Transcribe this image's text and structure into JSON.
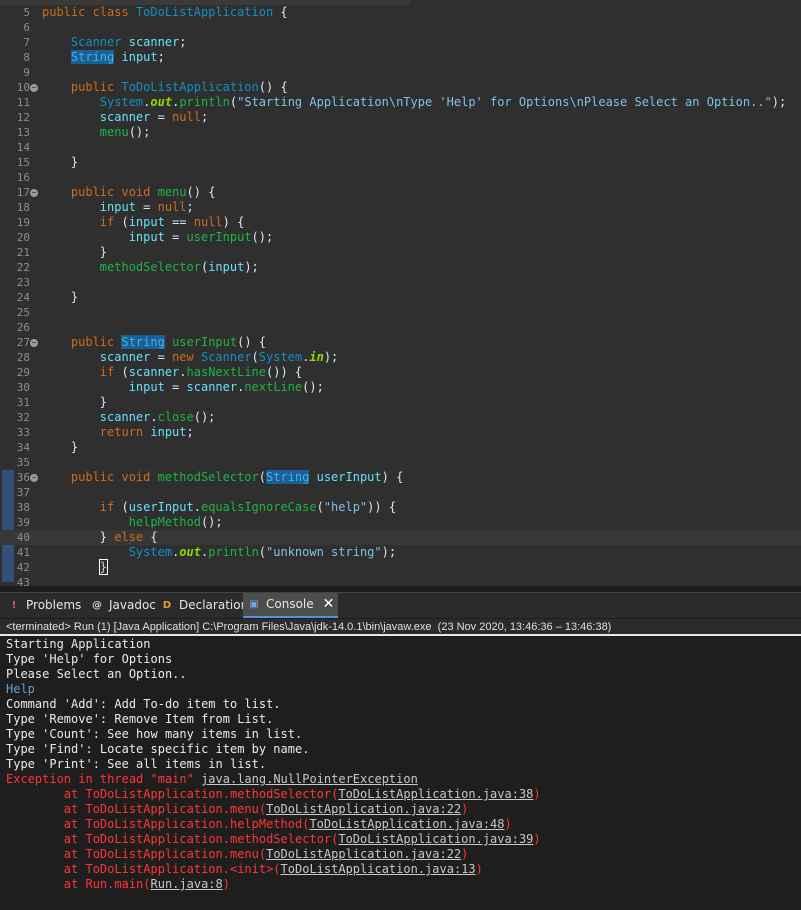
{
  "editor": {
    "lines": [
      {
        "n": "5",
        "fold": false,
        "tokens": [
          [
            "kw",
            "public class "
          ],
          [
            "ty",
            "ToDoListApplication"
          ],
          [
            "pl",
            " {"
          ]
        ]
      },
      {
        "n": "6",
        "fold": false,
        "tokens": []
      },
      {
        "n": "7",
        "fold": false,
        "tokens": [
          [
            "pl",
            "    "
          ],
          [
            "ty",
            "Scanner"
          ],
          [
            "pl",
            " "
          ],
          [
            "fd",
            "scanner"
          ],
          [
            "pl",
            ";"
          ]
        ]
      },
      {
        "n": "8",
        "fold": false,
        "tokens": [
          [
            "pl",
            "    "
          ],
          [
            "hl",
            "String"
          ],
          [
            "pl",
            " "
          ],
          [
            "fd",
            "input"
          ],
          [
            "pl",
            ";"
          ]
        ]
      },
      {
        "n": "9",
        "fold": false,
        "tokens": []
      },
      {
        "n": "10",
        "fold": true,
        "tokens": [
          [
            "pl",
            "    "
          ],
          [
            "kw",
            "public "
          ],
          [
            "ty",
            "ToDoListApplication"
          ],
          [
            "pl",
            "() {"
          ]
        ]
      },
      {
        "n": "11",
        "fold": false,
        "tokens": [
          [
            "pl",
            "        "
          ],
          [
            "ty",
            "System"
          ],
          [
            "pl",
            "."
          ],
          [
            "sf",
            "out"
          ],
          [
            "pl",
            "."
          ],
          [
            "mt",
            "println"
          ],
          [
            "pl",
            "("
          ],
          [
            "st",
            "\"Starting Application\\nType 'Help' for Options\\nPlease Select an Option..\""
          ],
          [
            "pl",
            ");"
          ]
        ]
      },
      {
        "n": "12",
        "fold": false,
        "tokens": [
          [
            "pl",
            "        "
          ],
          [
            "fd",
            "scanner"
          ],
          [
            "pl",
            " = "
          ],
          [
            "kw",
            "null"
          ],
          [
            "pl",
            ";"
          ]
        ]
      },
      {
        "n": "13",
        "fold": false,
        "tokens": [
          [
            "pl",
            "        "
          ],
          [
            "mt",
            "menu"
          ],
          [
            "pl",
            "();"
          ]
        ]
      },
      {
        "n": "14",
        "fold": false,
        "tokens": []
      },
      {
        "n": "15",
        "fold": false,
        "tokens": [
          [
            "pl",
            "    }"
          ]
        ]
      },
      {
        "n": "16",
        "fold": false,
        "tokens": []
      },
      {
        "n": "17",
        "fold": true,
        "tokens": [
          [
            "pl",
            "    "
          ],
          [
            "kw",
            "public void "
          ],
          [
            "mt",
            "menu"
          ],
          [
            "pl",
            "() {"
          ]
        ]
      },
      {
        "n": "18",
        "fold": false,
        "tokens": [
          [
            "pl",
            "        "
          ],
          [
            "fd",
            "input"
          ],
          [
            "pl",
            " = "
          ],
          [
            "kw",
            "null"
          ],
          [
            "pl",
            ";"
          ]
        ]
      },
      {
        "n": "19",
        "fold": false,
        "tokens": [
          [
            "pl",
            "        "
          ],
          [
            "kw",
            "if"
          ],
          [
            "pl",
            " ("
          ],
          [
            "fd",
            "input"
          ],
          [
            "pl",
            " == "
          ],
          [
            "kw",
            "null"
          ],
          [
            "pl",
            ") {"
          ]
        ]
      },
      {
        "n": "20",
        "fold": false,
        "tokens": [
          [
            "pl",
            "            "
          ],
          [
            "fd",
            "input"
          ],
          [
            "pl",
            " = "
          ],
          [
            "mt",
            "userInput"
          ],
          [
            "pl",
            "();"
          ]
        ]
      },
      {
        "n": "21",
        "fold": false,
        "tokens": [
          [
            "pl",
            "        }"
          ]
        ]
      },
      {
        "n": "22",
        "fold": false,
        "tokens": [
          [
            "pl",
            "        "
          ],
          [
            "mt",
            "methodSelector"
          ],
          [
            "pl",
            "("
          ],
          [
            "fd",
            "input"
          ],
          [
            "pl",
            ");"
          ]
        ]
      },
      {
        "n": "23",
        "fold": false,
        "tokens": []
      },
      {
        "n": "24",
        "fold": false,
        "tokens": [
          [
            "pl",
            "    }"
          ]
        ]
      },
      {
        "n": "25",
        "fold": false,
        "tokens": []
      },
      {
        "n": "26",
        "fold": false,
        "tokens": []
      },
      {
        "n": "27",
        "fold": true,
        "tokens": [
          [
            "pl",
            "    "
          ],
          [
            "kw",
            "public "
          ],
          [
            "hl",
            "String"
          ],
          [
            "pl",
            " "
          ],
          [
            "mt",
            "userInput"
          ],
          [
            "pl",
            "() {"
          ]
        ]
      },
      {
        "n": "28",
        "fold": false,
        "tokens": [
          [
            "pl",
            "        "
          ],
          [
            "fd",
            "scanner"
          ],
          [
            "pl",
            " = "
          ],
          [
            "kw",
            "new "
          ],
          [
            "ty",
            "Scanner"
          ],
          [
            "pl",
            "("
          ],
          [
            "ty",
            "System"
          ],
          [
            "pl",
            "."
          ],
          [
            "sf",
            "in"
          ],
          [
            "pl",
            ");"
          ]
        ]
      },
      {
        "n": "29",
        "fold": false,
        "tokens": [
          [
            "pl",
            "        "
          ],
          [
            "kw",
            "if"
          ],
          [
            "pl",
            " ("
          ],
          [
            "fd",
            "scanner"
          ],
          [
            "pl",
            "."
          ],
          [
            "mt",
            "hasNextLine"
          ],
          [
            "pl",
            "()) {"
          ]
        ]
      },
      {
        "n": "30",
        "fold": false,
        "tokens": [
          [
            "pl",
            "            "
          ],
          [
            "fd",
            "input"
          ],
          [
            "pl",
            " = "
          ],
          [
            "fd",
            "scanner"
          ],
          [
            "pl",
            "."
          ],
          [
            "mt",
            "nextLine"
          ],
          [
            "pl",
            "();"
          ]
        ]
      },
      {
        "n": "31",
        "fold": false,
        "tokens": [
          [
            "pl",
            "        }"
          ]
        ]
      },
      {
        "n": "32",
        "fold": false,
        "tokens": [
          [
            "pl",
            "        "
          ],
          [
            "fd",
            "scanner"
          ],
          [
            "pl",
            "."
          ],
          [
            "mt",
            "close"
          ],
          [
            "pl",
            "();"
          ]
        ]
      },
      {
        "n": "33",
        "fold": false,
        "tokens": [
          [
            "pl",
            "        "
          ],
          [
            "kw",
            "return "
          ],
          [
            "fd",
            "input"
          ],
          [
            "pl",
            ";"
          ]
        ]
      },
      {
        "n": "34",
        "fold": false,
        "tokens": [
          [
            "pl",
            "    }"
          ]
        ]
      },
      {
        "n": "35",
        "fold": false,
        "tokens": []
      },
      {
        "n": "36",
        "fold": true,
        "tokens": [
          [
            "pl",
            "    "
          ],
          [
            "kw",
            "public void "
          ],
          [
            "mt",
            "methodSelector"
          ],
          [
            "pl",
            "("
          ],
          [
            "hl",
            "String"
          ],
          [
            "pl",
            " "
          ],
          [
            "fd",
            "userInput"
          ],
          [
            "pl",
            ") {"
          ]
        ]
      },
      {
        "n": "37",
        "fold": false,
        "tokens": []
      },
      {
        "n": "38",
        "fold": false,
        "tokens": [
          [
            "pl",
            "        "
          ],
          [
            "kw",
            "if"
          ],
          [
            "pl",
            " ("
          ],
          [
            "fd",
            "userInput"
          ],
          [
            "pl",
            "."
          ],
          [
            "mt",
            "equalsIgnoreCase"
          ],
          [
            "pl",
            "("
          ],
          [
            "st",
            "\"help\""
          ],
          [
            "pl",
            ")) {"
          ]
        ]
      },
      {
        "n": "39",
        "fold": false,
        "tokens": [
          [
            "pl",
            "            "
          ],
          [
            "mt",
            "helpMethod"
          ],
          [
            "pl",
            "();"
          ]
        ]
      },
      {
        "n": "40",
        "fold": false,
        "current": true,
        "tokens": [
          [
            "pl",
            "        } "
          ],
          [
            "kw",
            "else"
          ],
          [
            "pl",
            " {"
          ]
        ]
      },
      {
        "n": "41",
        "fold": false,
        "tokens": [
          [
            "pl",
            "            "
          ],
          [
            "ty",
            "System"
          ],
          [
            "pl",
            "."
          ],
          [
            "sf",
            "out"
          ],
          [
            "pl",
            "."
          ],
          [
            "mt",
            "println"
          ],
          [
            "pl",
            "("
          ],
          [
            "st",
            "\"unknown string\""
          ],
          [
            "pl",
            ");"
          ]
        ]
      },
      {
        "n": "42",
        "fold": false,
        "tokens": [
          [
            "pl",
            "        "
          ],
          [
            "cur",
            "}"
          ]
        ]
      },
      {
        "n": "43",
        "fold": false,
        "tokens": []
      }
    ]
  },
  "tabs": [
    {
      "label": "Problems",
      "icon": "problems-icon",
      "glyph": "!",
      "color": "#e05555",
      "active": false
    },
    {
      "label": "Javadoc",
      "icon": "javadoc-icon",
      "glyph": "@",
      "color": "#d0d0d0",
      "active": false
    },
    {
      "label": "Declaration",
      "icon": "declaration-icon",
      "glyph": "D",
      "color": "#e0a040",
      "active": false
    },
    {
      "label": "Console",
      "icon": "console-icon",
      "glyph": "▣",
      "color": "#6fa8dc",
      "active": true
    }
  ],
  "console": {
    "status": "<terminated> Run (1) [Java Application] C:\\Program Files\\Java\\jdk-14.0.1\\bin\\javaw.exe  (23 Nov 2020, 13:46:36 – 13:46:38)",
    "lines": [
      [
        [
          "out",
          "Starting Application"
        ]
      ],
      [
        [
          "out",
          "Type 'Help' for Options"
        ]
      ],
      [
        [
          "out",
          "Please Select an Option.."
        ]
      ],
      [
        [
          "in",
          "Help"
        ]
      ],
      [
        [
          "out",
          "Command 'Add': Add To-do item to list."
        ]
      ],
      [
        [
          "out",
          "Type 'Remove': Remove Item from List."
        ]
      ],
      [
        [
          "out",
          "Type 'Count': See how many items in list."
        ]
      ],
      [
        [
          "out",
          "Type 'Find': Locate specific item by name."
        ]
      ],
      [
        [
          "out",
          "Type 'Print': See all items in list."
        ]
      ],
      [
        [
          "err",
          "Exception in thread \"main\" "
        ],
        [
          "lnk",
          "java.lang.NullPointerException"
        ]
      ],
      [
        [
          "err",
          "        at ToDoListApplication.methodSelector("
        ],
        [
          "lnk",
          "ToDoListApplication.java:38"
        ],
        [
          "err",
          ")"
        ]
      ],
      [
        [
          "err",
          "        at ToDoListApplication.menu("
        ],
        [
          "lnk",
          "ToDoListApplication.java:22"
        ],
        [
          "err",
          ")"
        ]
      ],
      [
        [
          "err",
          "        at ToDoListApplication.helpMethod("
        ],
        [
          "lnk",
          "ToDoListApplication.java:48"
        ],
        [
          "err",
          ")"
        ]
      ],
      [
        [
          "err",
          "        at ToDoListApplication.methodSelector("
        ],
        [
          "lnk",
          "ToDoListApplication.java:39"
        ],
        [
          "err",
          ")"
        ]
      ],
      [
        [
          "err",
          "        at ToDoListApplication.menu("
        ],
        [
          "lnk",
          "ToDoListApplication.java:22"
        ],
        [
          "err",
          ")"
        ]
      ],
      [
        [
          "err",
          "        at ToDoListApplication.<init>("
        ],
        [
          "lnk",
          "ToDoListApplication.java:13"
        ],
        [
          "err",
          ")"
        ]
      ],
      [
        [
          "err",
          "        at Run.main("
        ],
        [
          "lnk",
          "Run.java:8"
        ],
        [
          "err",
          ")"
        ]
      ]
    ]
  }
}
